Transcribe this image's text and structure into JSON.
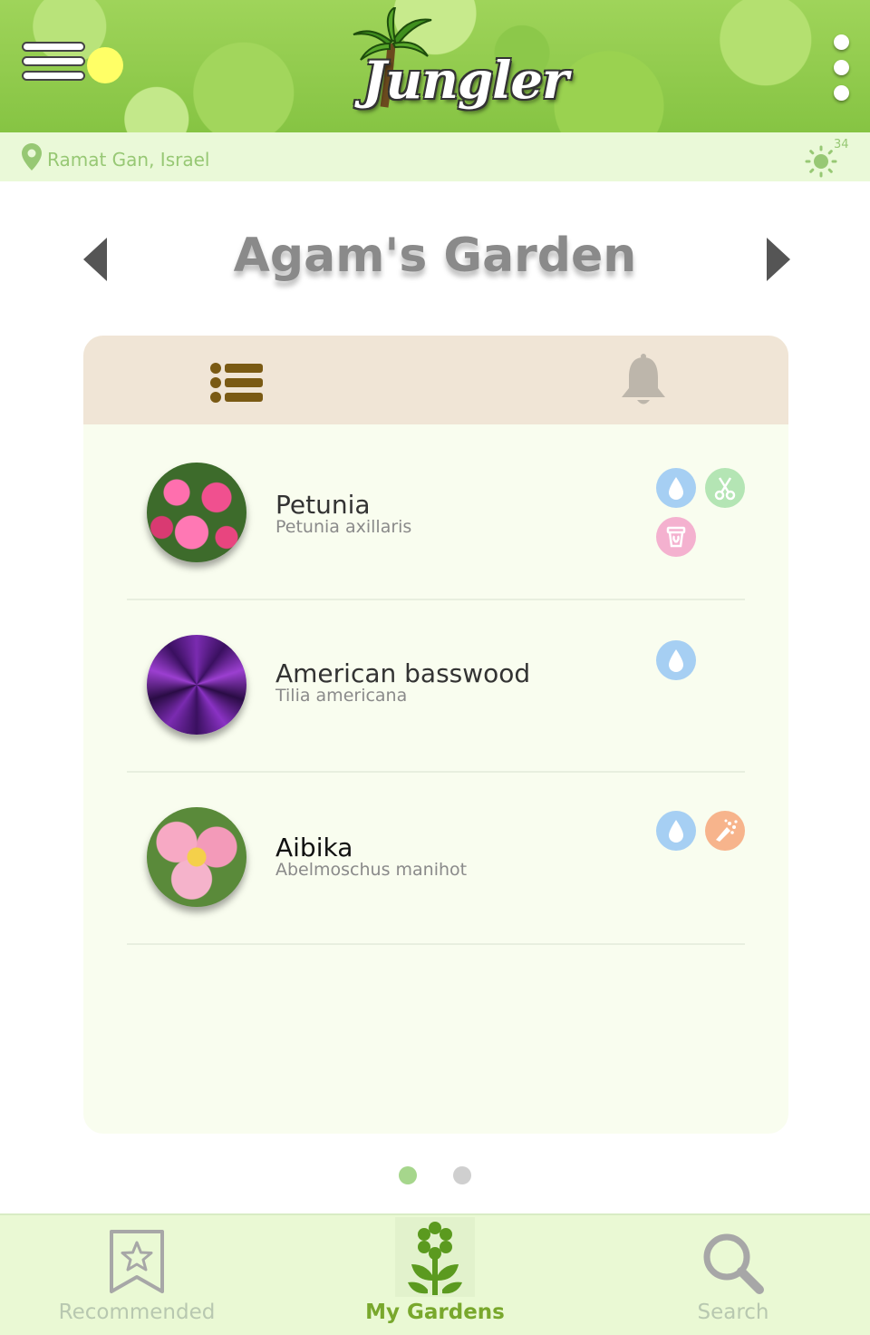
{
  "header": {
    "logo_text": "Jungler",
    "location": "Ramat Gan, Israel",
    "temperature": "34",
    "weather_icon": "sun-icon"
  },
  "garden": {
    "title": "Agam's Garden"
  },
  "tabs": {
    "list_icon": "list-icon",
    "notifications_icon": "bell-icon"
  },
  "plants": [
    {
      "name": "Petunia",
      "scientific": "Petunia axillaris",
      "tasks": [
        "water",
        "prune",
        "repot"
      ]
    },
    {
      "name": "American basswood",
      "scientific": "Tilia americana",
      "tasks": [
        "water"
      ]
    },
    {
      "name": "Aibika",
      "scientific": "Abelmoschus manihot",
      "tasks": [
        "water",
        "fertilize"
      ]
    }
  ],
  "pager": {
    "pages": 2,
    "current": 1
  },
  "bottom_nav": {
    "recommended": "Recommended",
    "my_gardens": "My Gardens",
    "search": "Search",
    "active": "my_gardens"
  },
  "colors": {
    "brand_green": "#79a82d",
    "water": "#a6cff3",
    "prune": "#b4e5b4",
    "repot": "#f4b1cf",
    "fertilize": "#f7b48c"
  }
}
